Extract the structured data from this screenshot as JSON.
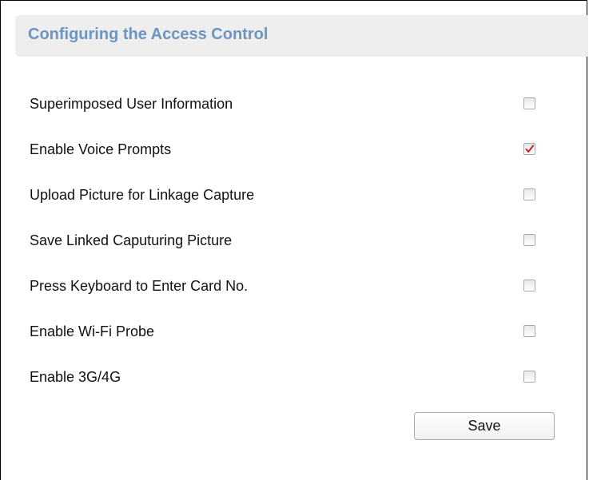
{
  "header": {
    "title": "Configuring the Access Control"
  },
  "options": [
    {
      "label": "Superimposed User Information",
      "checked": false
    },
    {
      "label": "Enable Voice Prompts",
      "checked": true
    },
    {
      "label": "Upload Picture for Linkage Capture",
      "checked": false
    },
    {
      "label": "Save Linked Caputuring Picture",
      "checked": false
    },
    {
      "label": "Press Keyboard to Enter Card No.",
      "checked": false
    },
    {
      "label": "Enable Wi-Fi Probe",
      "checked": false
    },
    {
      "label": "Enable 3G/4G",
      "checked": false
    }
  ],
  "actions": {
    "save_label": "Save"
  },
  "colors": {
    "title": "#6d95bf",
    "checkmark": "#cc1f1f"
  }
}
